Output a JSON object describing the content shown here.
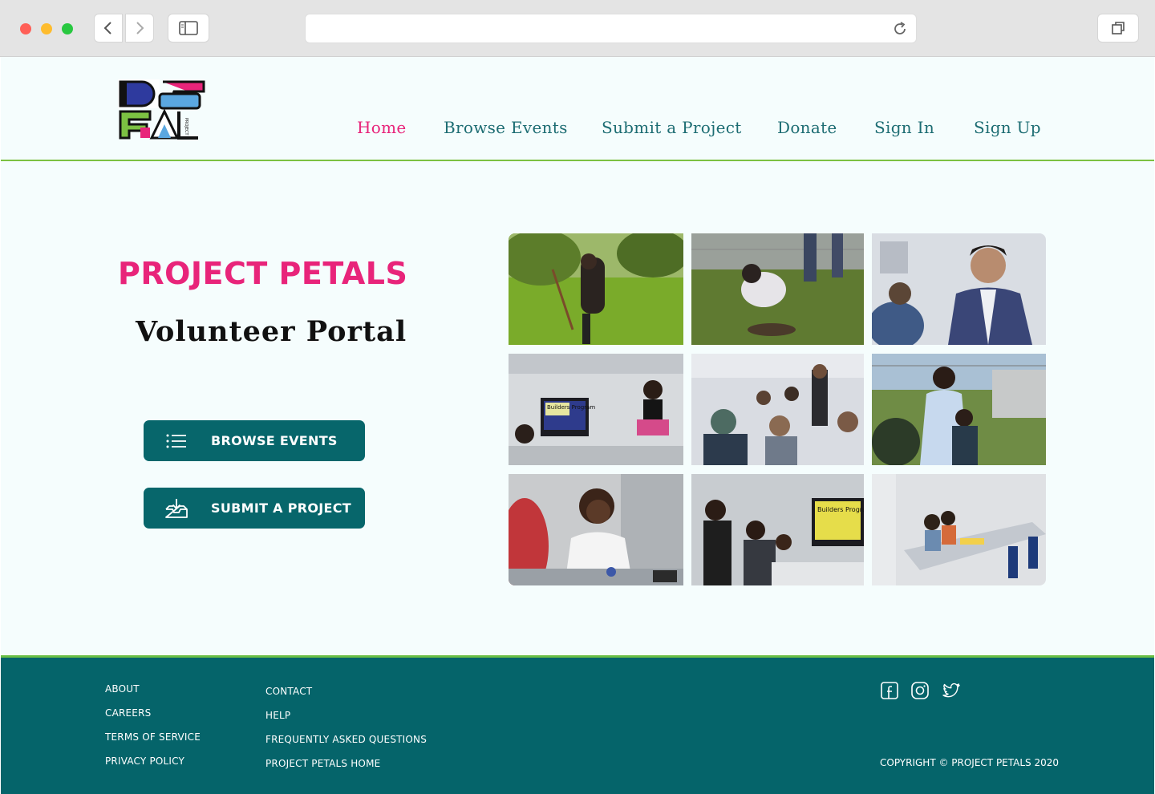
{
  "browser": {
    "url": ""
  },
  "header": {
    "logo_alt": "PROJECT PETALS",
    "logo_small_text": "PROJECT",
    "nav": [
      {
        "label": "Home",
        "active": true
      },
      {
        "label": "Browse Events",
        "active": false
      },
      {
        "label": "Submit a Project",
        "active": false
      },
      {
        "label": "Donate",
        "active": false
      },
      {
        "label": "Sign In",
        "active": false
      },
      {
        "label": "Sign Up",
        "active": false
      }
    ]
  },
  "hero": {
    "title": "PROJECT PETALS",
    "subtitle": "Volunteer Portal",
    "buttons": {
      "browse": {
        "label": "BROWSE EVENTS",
        "icon": "list-icon"
      },
      "submit": {
        "label": "SUBMIT A PROJECT",
        "icon": "inbox-download-icon"
      }
    }
  },
  "gallery": {
    "photos": [
      {
        "name": "volunteer-digging-photo"
      },
      {
        "name": "volunteer-planting-photo"
      },
      {
        "name": "man-in-plaid-blazer-photo"
      },
      {
        "name": "builders-program-class-photo",
        "screen_text": "Builders Program"
      },
      {
        "name": "students-classroom-photo"
      },
      {
        "name": "volunteers-outdoor-smiling-photo"
      },
      {
        "name": "woman-smiling-classroom-photo"
      },
      {
        "name": "builders-program-students-photo",
        "screen_text": "Builders Program"
      },
      {
        "name": "children-at-table-photo"
      }
    ]
  },
  "footer": {
    "col1": [
      "ABOUT",
      "CAREERS",
      "TERMS OF SERVICE",
      "PRIVACY POLICY"
    ],
    "col2": [
      "CONTACT",
      "HELP",
      "FREQUENTLY ASKED QUESTIONS",
      "PROJECT PETALS HOME"
    ],
    "social": [
      "facebook-icon",
      "instagram-icon",
      "twitter-icon"
    ],
    "copyright": "COPYRIGHT © PROJECT PETALS 2020"
  },
  "colors": {
    "accent_pink": "#e8247a",
    "brand_teal": "#07666b",
    "footer_teal": "#05646a",
    "green_rule": "#7cc142",
    "page_bg": "#f5fdfd"
  }
}
